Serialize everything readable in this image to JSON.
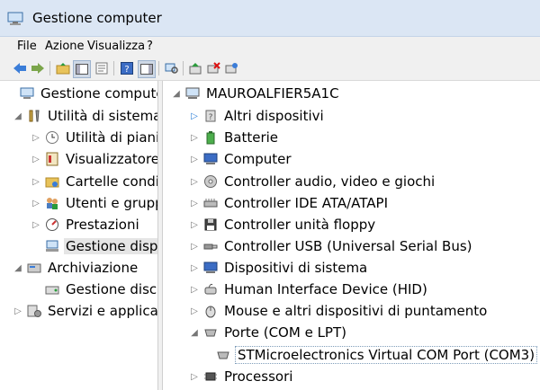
{
  "window": {
    "title": "Gestione computer"
  },
  "menu": [
    "File",
    "Azione",
    "Visualizza",
    "?"
  ],
  "left_tree": [
    {
      "label": "Gestione computer (",
      "icon": "computer-management-icon"
    },
    {
      "label": "Utilità di sistema",
      "icon": "tools-icon"
    },
    {
      "label": "Utilità di pianific",
      "icon": "clock-icon"
    },
    {
      "label": "Visualizzatore ev",
      "icon": "event-viewer-icon"
    },
    {
      "label": "Cartelle condivis",
      "icon": "shared-folder-icon"
    },
    {
      "label": "Utenti e gruppi",
      "icon": "users-icon"
    },
    {
      "label": "Prestazioni",
      "icon": "performance-icon"
    },
    {
      "label": "Gestione dispos",
      "icon": "device-manager-icon"
    },
    {
      "label": "Archiviazione",
      "icon": "storage-icon"
    },
    {
      "label": "Gestione disco",
      "icon": "disk-icon"
    },
    {
      "label": "Servizi e applicazio",
      "icon": "services-icon"
    }
  ],
  "right_tree": {
    "root": "MAUROALFIER5A1C",
    "items": [
      {
        "label": "Altri dispositivi",
        "icon": "unknown-device-icon"
      },
      {
        "label": "Batterie",
        "icon": "battery-icon"
      },
      {
        "label": "Computer",
        "icon": "computer-icon"
      },
      {
        "label": "Controller audio, video e giochi",
        "icon": "audio-icon"
      },
      {
        "label": "Controller IDE ATA/ATAPI",
        "icon": "ide-icon"
      },
      {
        "label": "Controller unità floppy",
        "icon": "floppy-icon"
      },
      {
        "label": "Controller USB (Universal Serial Bus)",
        "icon": "usb-icon"
      },
      {
        "label": "Dispositivi di sistema",
        "icon": "system-device-icon"
      },
      {
        "label": "Human Interface Device (HID)",
        "icon": "hid-icon"
      },
      {
        "label": "Mouse e altri dispositivi di puntamento",
        "icon": "mouse-icon"
      },
      {
        "label": "Porte (COM e LPT)",
        "icon": "port-icon"
      },
      {
        "label": "STMicroelectronics Virtual COM Port (COM3)",
        "icon": "com-port-icon"
      },
      {
        "label": "Processori",
        "icon": "processor-icon"
      }
    ]
  }
}
